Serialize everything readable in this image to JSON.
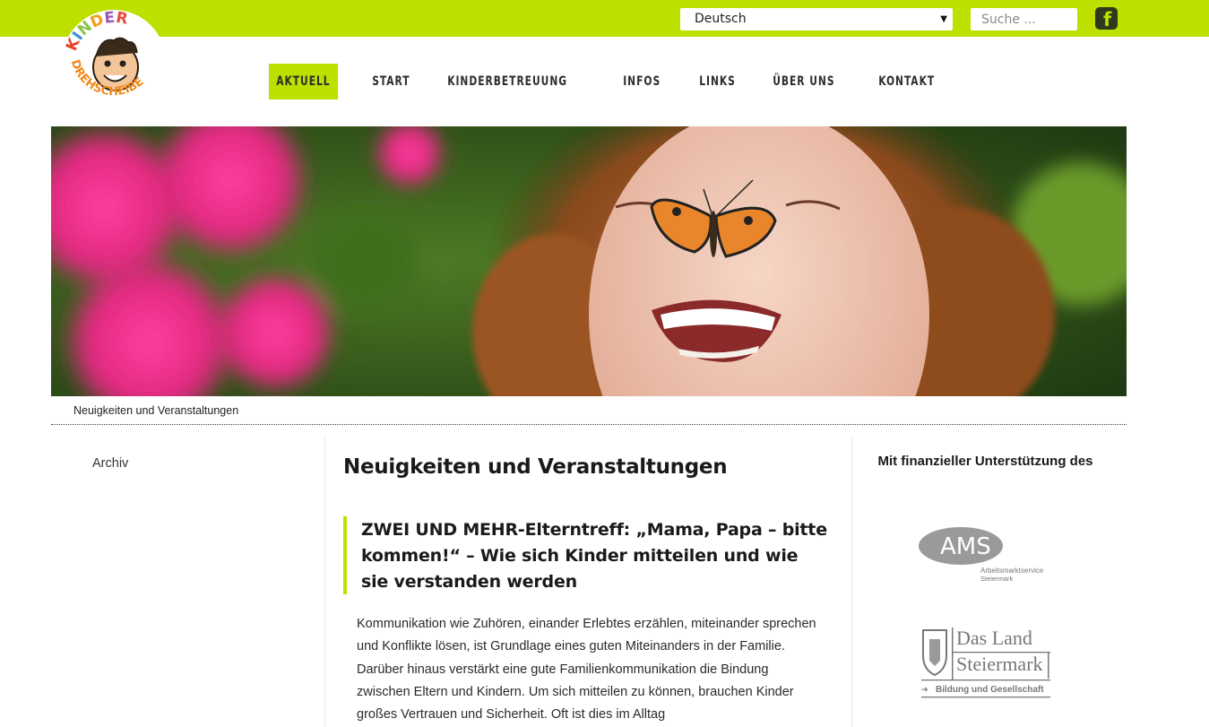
{
  "header": {
    "language": {
      "selected": "Deutsch"
    },
    "search": {
      "placeholder": "Suche ..."
    },
    "facebook_icon": "facebook-icon",
    "accent_color": "#bde000"
  },
  "logo": {
    "line1": "KINDER",
    "line2": "DREHSCHEIBE"
  },
  "nav": {
    "items": [
      {
        "label": "AKTUELL",
        "active": true
      },
      {
        "label": "START"
      },
      {
        "label": "KINDERBETREUUNG"
      },
      {
        "label": "INFOS"
      },
      {
        "label": "LINKS"
      },
      {
        "label": "ÜBER UNS"
      },
      {
        "label": "KONTAKT"
      }
    ]
  },
  "breadcrumb": "Neuigkeiten und Veranstaltungen",
  "sidebar": {
    "archive_label": "Archiv"
  },
  "main": {
    "title": "Neuigkeiten und Veranstaltungen",
    "article": {
      "title": "ZWEI UND MEHR-Elterntreff: „Mama, Papa – bitte kommen!“ – Wie sich Kinder mitteilen und wie sie verstanden werden",
      "body": "Kommunikation wie Zuhören, einander Erlebtes erzählen, miteinander sprechen und Konflikte lösen, ist Grundlage eines guten Miteinanders in der Familie. Darüber hinaus verstärkt eine gute Familienkommunikation die Bindung zwischen Eltern und Kindern. Um sich mitteilen zu können, brauchen Kinder großes Vertrauen und Sicherheit. Oft ist dies im Alltag"
    }
  },
  "support": {
    "heading": "Mit finanzieller Unterstützung des",
    "ams": {
      "name": "AMS",
      "sub1": "Arbeitsmarktservice",
      "sub2": "Steiermark"
    },
    "land": {
      "line1": "Das Land",
      "line2": "Steiermark",
      "line3": "Bildung und Gesellschaft"
    }
  }
}
